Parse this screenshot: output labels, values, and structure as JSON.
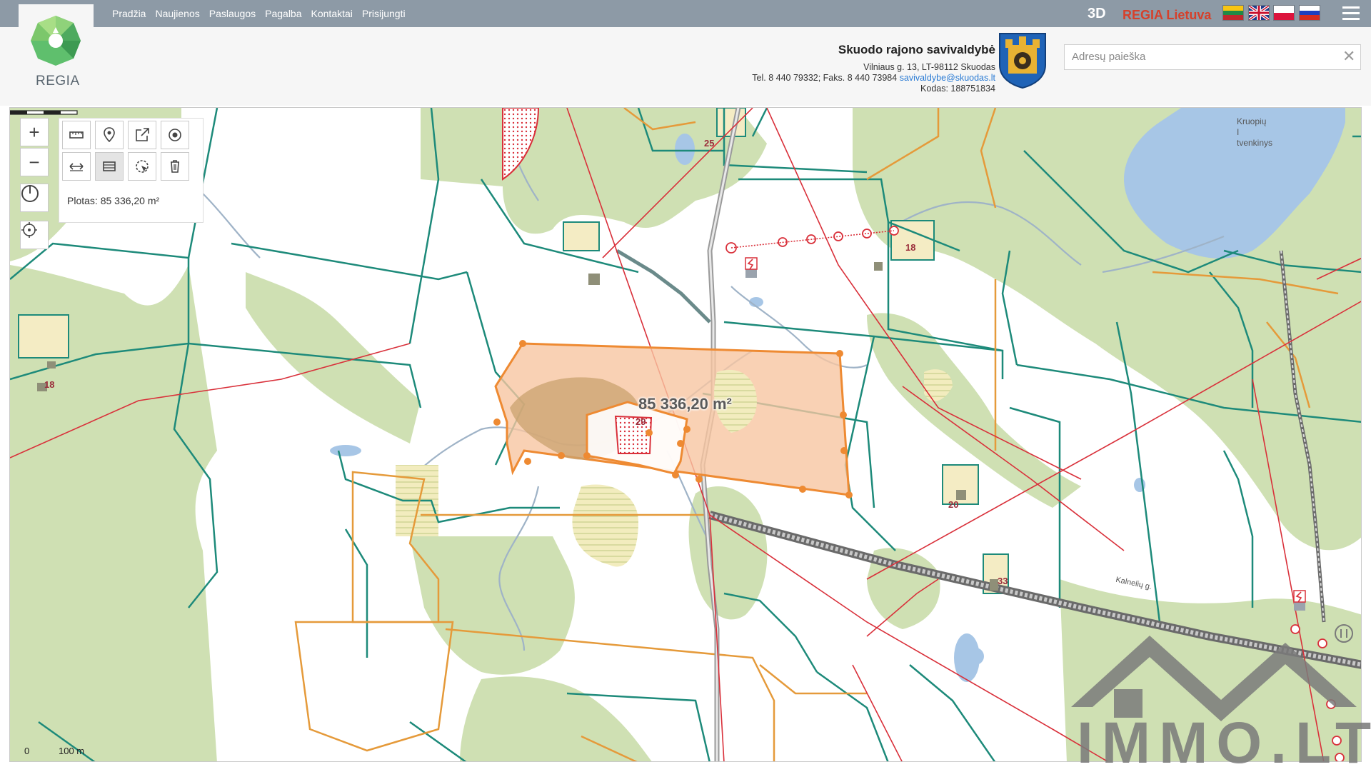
{
  "nav": {
    "items": [
      "Pradžia",
      "Naujienos",
      "Paslaugos",
      "Pagalba",
      "Kontaktai",
      "Prisijungti"
    ]
  },
  "top_right": {
    "mode_3d": "3D",
    "brand": "REGIA Lietuva",
    "languages": [
      "lt-flag",
      "en-flag",
      "pl-flag",
      "ru-flag"
    ]
  },
  "logo": {
    "text": "REGIA"
  },
  "municipality": {
    "name": "Skuodo rajono savivaldybė",
    "address": "Vilniaus g. 13, LT-98112 Skuodas",
    "phone_prefix": "Tel. 8 440 79332; Faks. 8 440 73984",
    "email": "savivaldybe@skuodas.lt",
    "code": "Kodas: 188751834"
  },
  "search": {
    "placeholder": "Adresų paieška"
  },
  "tools": {
    "area_text": "Plotas: 85 336,20 m²"
  },
  "map": {
    "measured_area": "85 336,20 m²",
    "parcel_numbers": [
      "25",
      "18",
      "18",
      "29",
      "20",
      "33"
    ],
    "lake_name": [
      "Kruopių",
      "I",
      "tvenkinys"
    ],
    "road_label": "Kalnelių g.",
    "scale": {
      "zero": "0",
      "distance": "100 m"
    }
  },
  "watermark": {
    "text": "IMMO.LT"
  },
  "colors": {
    "topbar": "#8d9aa6",
    "forest": "#cfe0b3",
    "water": "#a7c6e6",
    "parcel_border": "#1d8a7a",
    "measure_fill": "#f7c6a1",
    "measure_stroke": "#ee8a32",
    "power_line": "#d9303a"
  }
}
